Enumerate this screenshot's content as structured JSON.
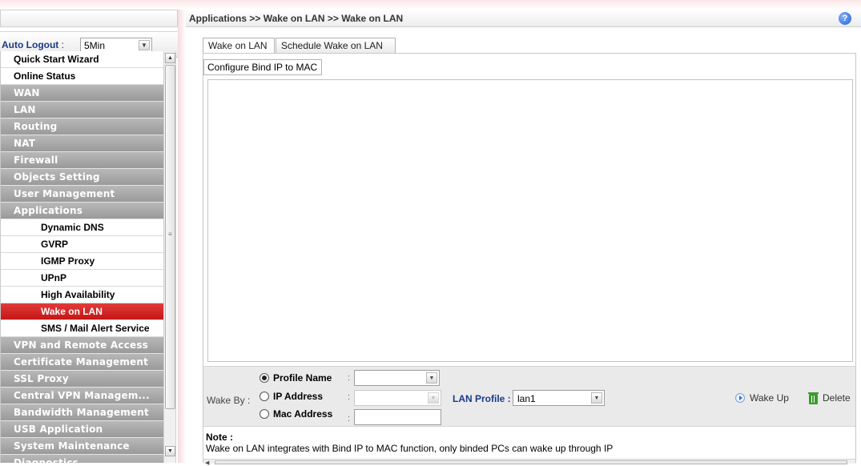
{
  "sidebar": {
    "auto_logout": {
      "label": "Auto Logout",
      "colon": " :",
      "value": "5Min"
    },
    "menu": [
      {
        "label": "Quick Start Wizard",
        "kind": "top"
      },
      {
        "label": "Online Status",
        "kind": "top"
      },
      {
        "label": "WAN",
        "kind": "cat"
      },
      {
        "label": "LAN",
        "kind": "cat"
      },
      {
        "label": "Routing",
        "kind": "cat"
      },
      {
        "label": "NAT",
        "kind": "cat"
      },
      {
        "label": "Firewall",
        "kind": "cat"
      },
      {
        "label": "Objects Setting",
        "kind": "cat"
      },
      {
        "label": "User Management",
        "kind": "cat"
      },
      {
        "label": "Applications",
        "kind": "cat"
      },
      {
        "label": "Dynamic DNS",
        "kind": "sub"
      },
      {
        "label": "GVRP",
        "kind": "sub"
      },
      {
        "label": "IGMP Proxy",
        "kind": "sub"
      },
      {
        "label": "UPnP",
        "kind": "sub"
      },
      {
        "label": "High Availability",
        "kind": "sub"
      },
      {
        "label": "Wake on LAN",
        "kind": "sub",
        "active": true
      },
      {
        "label": "SMS / Mail Alert Service",
        "kind": "sub"
      },
      {
        "label": "VPN and Remote Access",
        "kind": "cat"
      },
      {
        "label": "Certificate Management",
        "kind": "cat"
      },
      {
        "label": "SSL Proxy",
        "kind": "cat"
      },
      {
        "label": "Central VPN Managem...",
        "kind": "cat"
      },
      {
        "label": "Bandwidth Management",
        "kind": "cat"
      },
      {
        "label": "USB Application",
        "kind": "cat"
      },
      {
        "label": "System Maintenance",
        "kind": "cat"
      },
      {
        "label": "Diagnostics",
        "kind": "cat"
      }
    ]
  },
  "header": {
    "breadcrumb": "Applications >> Wake on LAN >> Wake on LAN",
    "help_icon": "?"
  },
  "tabs": [
    {
      "label": "Wake on LAN"
    },
    {
      "label": "Schedule Wake on LAN"
    }
  ],
  "subtab": {
    "label": "Configure Bind IP to MAC"
  },
  "wake": {
    "wake_by_label": "Wake By :",
    "options": [
      {
        "label": "Profile Name",
        "selected": true
      },
      {
        "label": "IP Address",
        "selected": false
      },
      {
        "label": "Mac Address",
        "selected": false
      }
    ],
    "profile_name_value": "",
    "ip_address_value": "",
    "mac_address_value": "",
    "lan_profile_label": "LAN Profile :",
    "lan_profile_value": "lan1",
    "wake_up_label": "Wake Up",
    "delete_label": "Delete"
  },
  "note": {
    "title": "Note :",
    "text": "Wake on LAN integrates with Bind IP to MAC function, only binded PCs can wake up through IP"
  },
  "colors": {
    "active_menu": "#d42a2a",
    "category_menu": "#a8a8a8",
    "link_blue": "#1a3a8a"
  }
}
